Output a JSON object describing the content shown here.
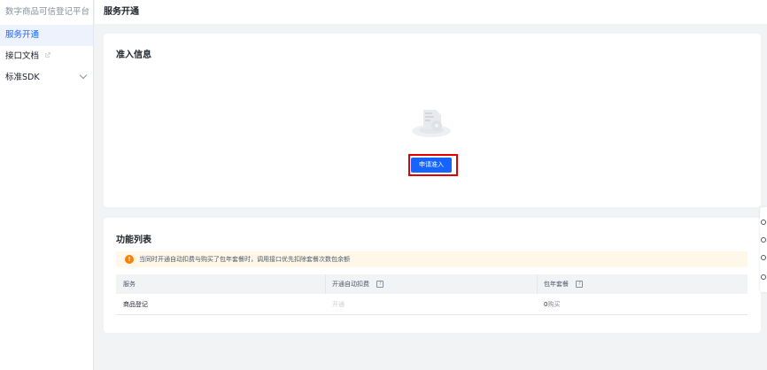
{
  "sidebar": {
    "title": "数字商品可信登记平台",
    "items": [
      {
        "label": "服务开通",
        "active": true
      },
      {
        "label": "接口文档",
        "icon": "external-link-icon"
      },
      {
        "label": "标准SDK",
        "icon": "chevron-down-icon"
      }
    ]
  },
  "header": {
    "title": "服务开通"
  },
  "access_card": {
    "title": "准入信息",
    "illustration": "empty-state-icon",
    "apply_button": "申请准入"
  },
  "features_card": {
    "title": "功能列表",
    "notice": "当同时开通自动扣费与购买了包年套餐时，调用接口优先扣除套餐次数包余额",
    "columns": [
      "服务",
      "开通自动扣费",
      "包年套餐"
    ],
    "rows": [
      {
        "service": "商品登记",
        "auto_deduct": "开通",
        "annual_count": "0",
        "annual_action": "购买"
      }
    ]
  },
  "colors": {
    "primary": "#1664ff",
    "highlight": "#e00000",
    "warning": "#ff7d00"
  }
}
